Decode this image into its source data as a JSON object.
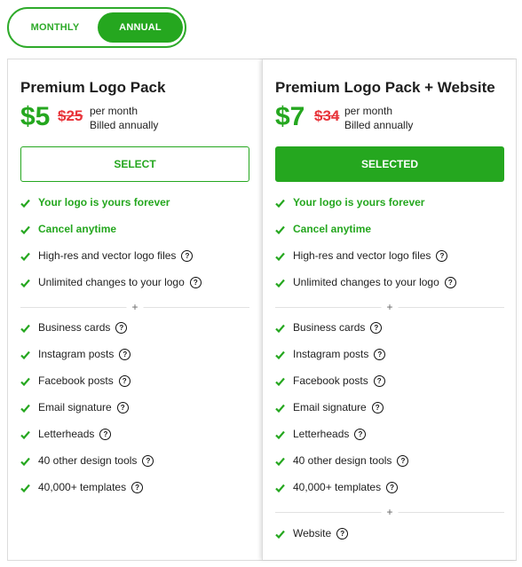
{
  "toggle": {
    "monthly": "MONTHLY",
    "annual": "ANNUAL",
    "selected": "ANNUAL"
  },
  "colors": {
    "accent": "#25a71f",
    "strike": "#e8343a"
  },
  "plans": [
    {
      "title": "Premium Logo Pack",
      "price": "$5",
      "old_price": "$25",
      "per": "per month",
      "billing": "Billed annually",
      "button": "SELECT",
      "highlights": [
        "Your logo is yours forever",
        "Cancel anytime"
      ],
      "core": [
        "High-res and vector logo files",
        "Unlimited changes to your logo"
      ],
      "separator": "+",
      "extras": [
        "Business cards",
        "Instagram posts",
        "Facebook posts",
        "Email signature",
        "Letterheads",
        "40 other design tools",
        "40,000+ templates"
      ]
    },
    {
      "title": "Premium Logo Pack + Website",
      "price": "$7",
      "old_price": "$34",
      "per": "per month",
      "billing": "Billed annually",
      "button": "SELECTED",
      "highlights": [
        "Your logo is yours forever",
        "Cancel anytime"
      ],
      "core": [
        "High-res and vector logo files",
        "Unlimited changes to your logo"
      ],
      "separator": "+",
      "extras": [
        "Business cards",
        "Instagram posts",
        "Facebook posts",
        "Email signature",
        "Letterheads",
        "40 other design tools",
        "40,000+ templates"
      ],
      "separator2": "+",
      "website": [
        "Website"
      ]
    }
  ],
  "icons": {
    "check": "check-icon",
    "help": "help-icon"
  }
}
